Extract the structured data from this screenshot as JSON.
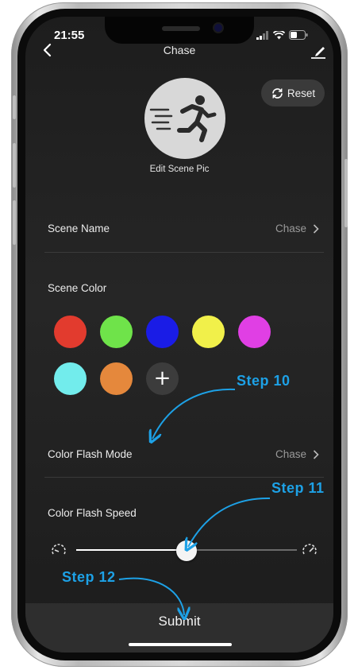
{
  "status_bar": {
    "time": "21:55"
  },
  "nav": {
    "title": "Chase"
  },
  "reset_label": "Reset",
  "scene_pic": {
    "caption": "Edit Scene Pic"
  },
  "scene_name": {
    "label": "Scene Name",
    "value": "Chase"
  },
  "scene_color": {
    "label": "Scene Color",
    "swatches": [
      "#e23b2e",
      "#6fe34a",
      "#1a1ce6",
      "#f1f04a",
      "#e03fe4",
      "#72ecec",
      "#e5883c"
    ],
    "add_label": "+"
  },
  "color_flash_mode": {
    "label": "Color Flash Mode",
    "value": "Chase"
  },
  "color_flash_speed": {
    "label": "Color Flash Speed",
    "level": 0.5
  },
  "submit_label": "Submit",
  "annotations": {
    "step10": "Step 10",
    "step11": "Step 11",
    "step12": "Step 12"
  }
}
